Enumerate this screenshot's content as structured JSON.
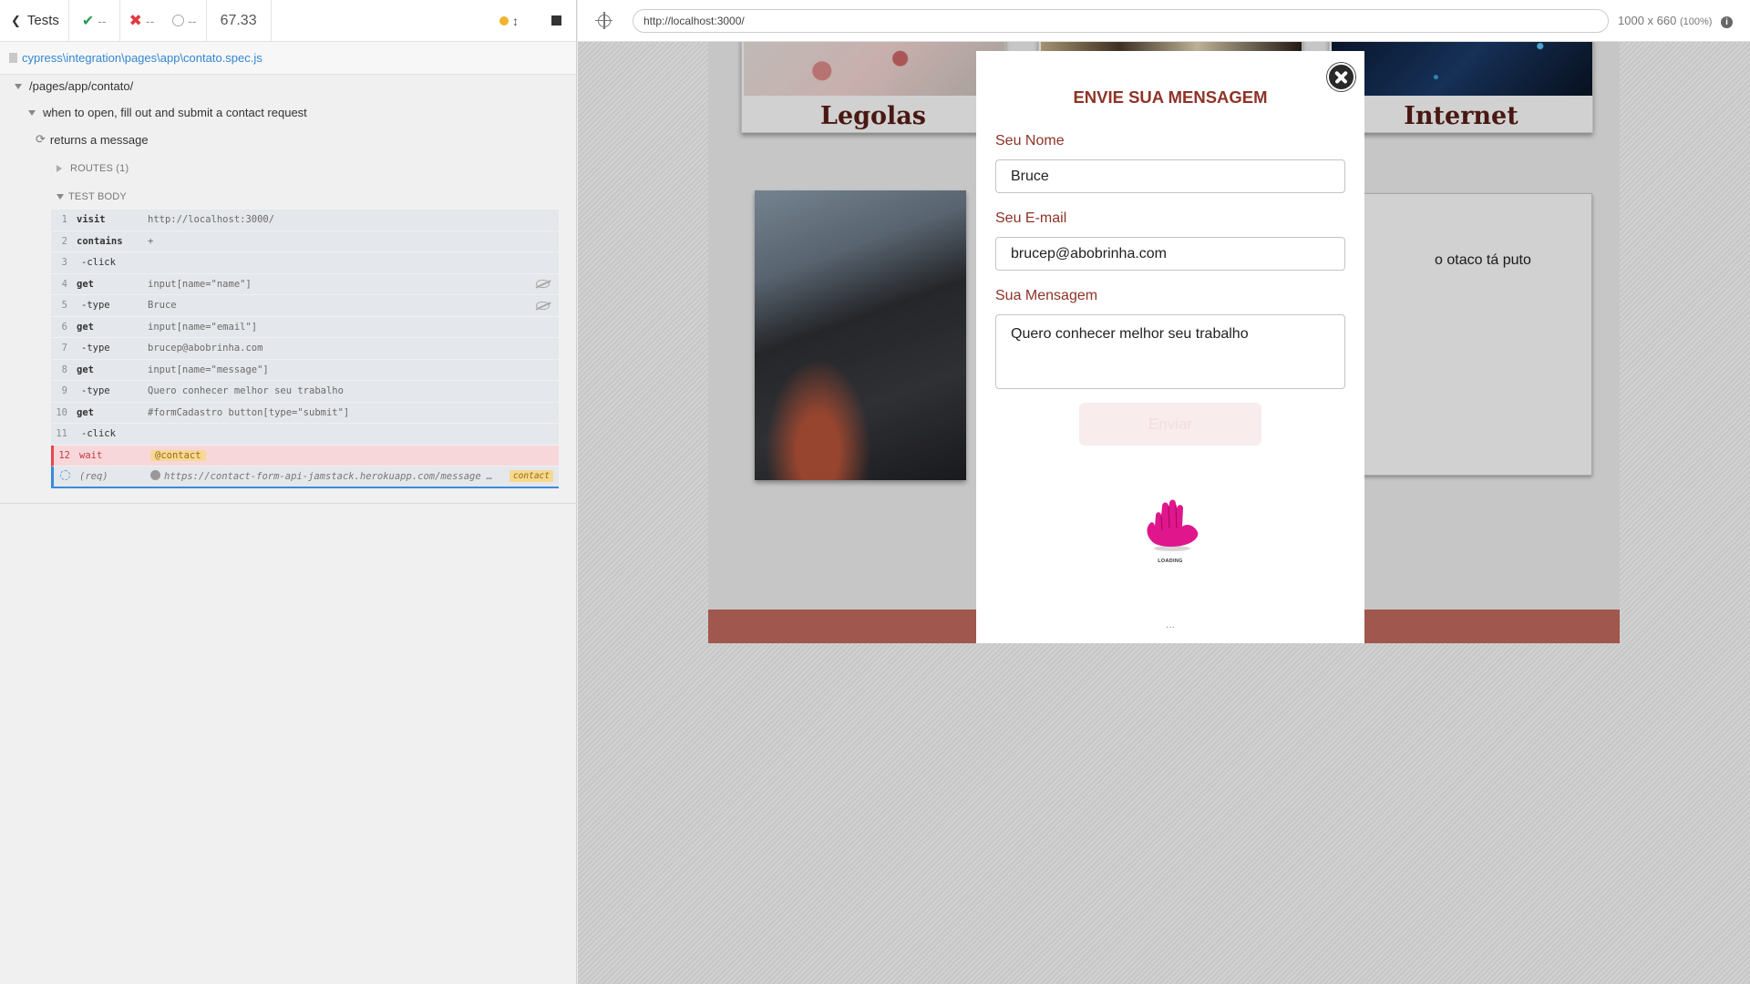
{
  "reporter": {
    "back_label": "Tests",
    "passed": "--",
    "failed": "--",
    "pending": "--",
    "duration": "67.33",
    "spec_path": "cypress\\integration\\pages\\app\\contato.spec.js",
    "suite": "/pages/app/contato/",
    "describe": "when to open, fill out and submit a contact request",
    "test": "returns a message",
    "routes_label": "ROUTES (1)",
    "test_body_label": "TEST BODY",
    "commands": [
      {
        "num": "1",
        "name": "visit",
        "msg": "http://localhost:3000/"
      },
      {
        "num": "2",
        "name": "contains",
        "msg": "+"
      },
      {
        "num": "3",
        "name": "-click",
        "msg": ""
      },
      {
        "num": "4",
        "name": "get",
        "msg": "input[name=\"name\"]"
      },
      {
        "num": "5",
        "name": "-type",
        "msg": "Bruce"
      },
      {
        "num": "6",
        "name": "get",
        "msg": "input[name=\"email\"]"
      },
      {
        "num": "7",
        "name": "-type",
        "msg": "brucep@abobrinha.com"
      },
      {
        "num": "8",
        "name": "get",
        "msg": "input[name=\"message\"]"
      },
      {
        "num": "9",
        "name": "-type",
        "msg": "Quero conhecer melhor seu trabalho"
      },
      {
        "num": "10",
        "name": "get",
        "msg": "#formCadastro button[type=\"submit\"]"
      },
      {
        "num": "11",
        "name": "-click",
        "msg": ""
      },
      {
        "num": "12",
        "name": "wait",
        "msg": "@contact"
      }
    ],
    "req_row": {
      "name": "(req)",
      "msg": "https://contact-form-api-jamstack.herokuapp.com/message …",
      "tag": "contact"
    }
  },
  "aut": {
    "url": "http://localhost:3000/",
    "viewport": "1000 x 660",
    "zoom": "(100%)",
    "cards": [
      "Legolas",
      "Internet"
    ],
    "text_card_snippet": "o otaco tá puto",
    "modal": {
      "title": "ENVIE SUA MENSAGEM",
      "name_label": "Seu Nome",
      "name_value": "Bruce",
      "email_label": "Seu E-mail",
      "email_value": "brucep@abobrinha.com",
      "message_label": "Sua Mensagem",
      "message_value": "Quero conhecer melhor seu trabalho",
      "submit_label": "Enviar",
      "loading_text": "LOADING",
      "footer_text": "..."
    }
  },
  "colors": {
    "accent": "#8e3327",
    "pass": "#2e9a4f",
    "fail": "#e0393e",
    "footer": "#c26b60",
    "loading_hand": "#e0168c"
  }
}
